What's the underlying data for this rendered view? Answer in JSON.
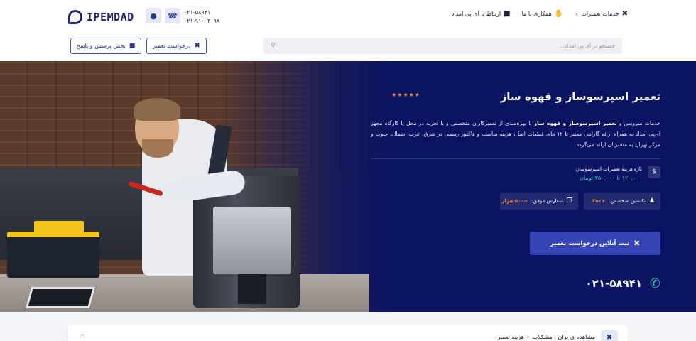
{
  "header": {
    "logo_text": "IPEMDAD",
    "phones": [
      "۰۲۱-۵۸۹۴۱",
      "۰۲۱-۹۱۰۰۳۰۹۸"
    ],
    "nav": [
      {
        "label": "خدمات تعمیرات",
        "icon": "repair-tools-icon"
      },
      {
        "label": "همکاری با ما",
        "icon": "handshake-icon"
      },
      {
        "label": "ارتباط با آی پی امداد",
        "icon": "support-agent-icon"
      }
    ],
    "search_placeholder": "جستجو در آی پی امداد...",
    "repair_request_label": "درخواست تعمیر",
    "faq_label": "بخش پرسش و پاسخ"
  },
  "hero": {
    "stars": "★★★★★",
    "title": "تعمیر اسپرسوساز و قهوه ساز",
    "desc_part1": "خدمات سرویس و ",
    "desc_bold": "تعمیر اسپرسوساز و قهوه ساز",
    "desc_part2": " با بهره‌مندی از تعمیرکاران متخصص و با تجربه در محل یا کارگاه مجهز آی‌پی امداد به همراه ارائه گارانتی معتبر تا ۱۲ ماه، قطعات اصل، هزینه مناسب و فاکتور رسمی در شرق، غرب، شمال، جنوب و مرکز تهران به مشتریان ارائه می‌گردد.",
    "price_label": "بازه هزینه تعمیرات اسپرسوساز:",
    "price_value": "۱۲۰,۰۰۰ تا ۳۵۰,۰۰۰ تومان",
    "tech_label": "تکنسین متخصص:",
    "tech_value": "+۲۵۰",
    "orders_label": "سفارش موفق:",
    "orders_value": "+۵۰۰ هزار",
    "cta_label": "ثبت آنلاین درخواست تعمیر",
    "hotline": "۰۲۱-۵۸۹۴۱"
  },
  "bottom": {
    "text": "مشاهده ی بران ، مشکلات + هزینه تعمیر"
  }
}
